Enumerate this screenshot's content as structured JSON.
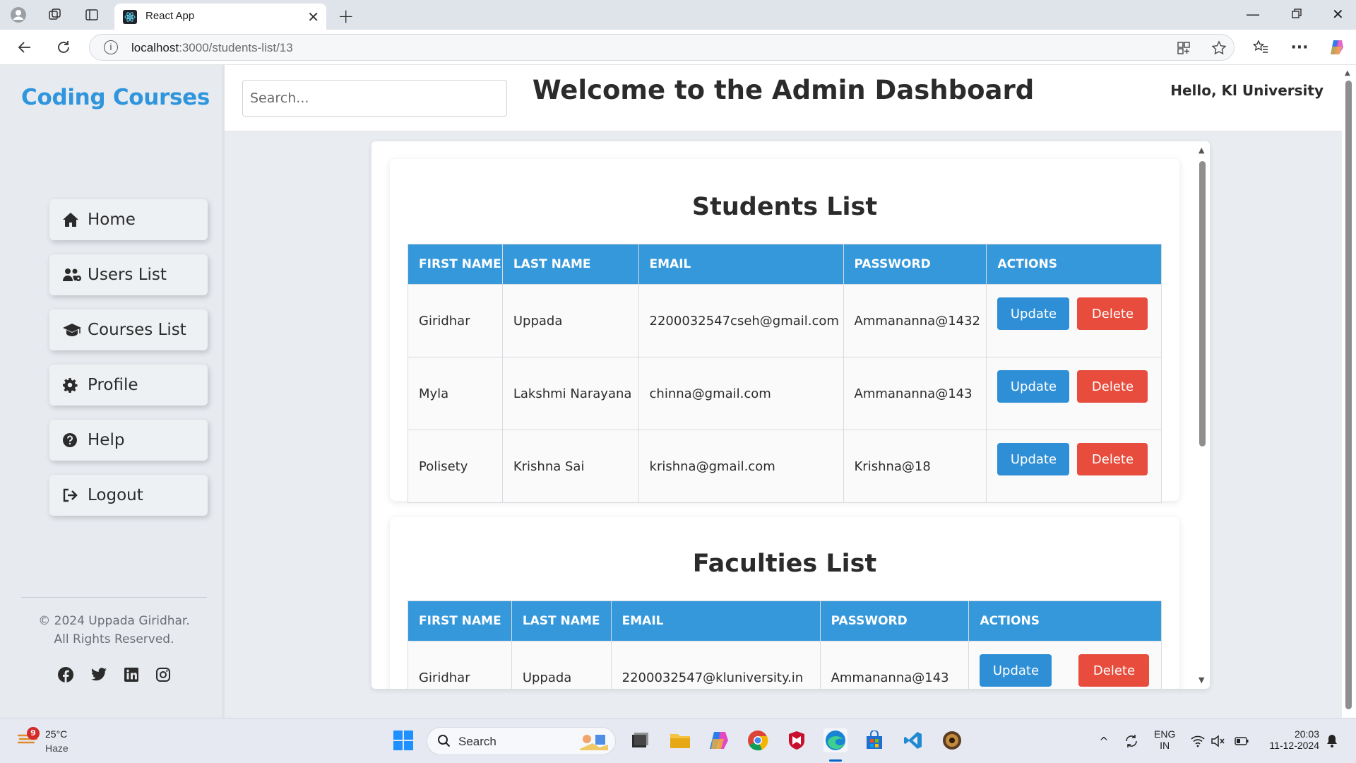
{
  "browser": {
    "tab_title": "React App",
    "url_host": "localhost",
    "url_path": ":3000/students-list/13"
  },
  "sidebar": {
    "brand": "Coding Courses",
    "items": [
      {
        "label": "Home",
        "icon": "home-icon"
      },
      {
        "label": "Users List",
        "icon": "users-icon"
      },
      {
        "label": "Courses List",
        "icon": "graduation-cap-icon"
      },
      {
        "label": "Profile",
        "icon": "gear-icon"
      },
      {
        "label": "Help",
        "icon": "question-icon"
      },
      {
        "label": "Logout",
        "icon": "logout-icon"
      }
    ],
    "copyright_line1": "© 2024 Uppada Giridhar.",
    "copyright_line2": "All Rights Reserved.",
    "social": [
      "facebook-icon",
      "twitter-icon",
      "linkedin-icon",
      "instagram-icon"
    ]
  },
  "header": {
    "search_placeholder": "Search...",
    "title": "Welcome to the Admin Dashboard",
    "greeting": "Hello, Kl University"
  },
  "students": {
    "title": "Students List",
    "columns": [
      "FIRST NAME",
      "LAST NAME",
      "EMAIL",
      "PASSWORD",
      "ACTIONS"
    ],
    "rows": [
      {
        "first": "Giridhar",
        "last": "Uppada",
        "email": "2200032547cseh@gmail.com",
        "password": "Ammananna@1432"
      },
      {
        "first": "Myla",
        "last": "Lakshmi Narayana",
        "email": "chinna@gmail.com",
        "password": "Ammananna@143"
      },
      {
        "first": "Polisety",
        "last": "Krishna Sai",
        "email": "krishna@gmail.com",
        "password": "Krishna@18"
      }
    ],
    "update_label": "Update",
    "delete_label": "Delete"
  },
  "faculties": {
    "title": "Faculties List",
    "columns": [
      "FIRST NAME",
      "LAST NAME",
      "EMAIL",
      "PASSWORD",
      "ACTIONS"
    ],
    "rows": [
      {
        "first": "Giridhar",
        "last": "Uppada",
        "email": "2200032547@kluniversity.in",
        "password": "Ammananna@143"
      }
    ],
    "update_label": "Update",
    "delete_label": "Delete"
  },
  "taskbar": {
    "temperature": "25°C",
    "weather": "Haze",
    "notification_count": "9",
    "search_label": "Search",
    "lang1": "ENG",
    "lang2": "IN",
    "time": "20:03",
    "date": "11-12-2024"
  },
  "colors": {
    "accent": "#3498db",
    "delete": "#e74c3c",
    "brand": "#2f95dc"
  }
}
